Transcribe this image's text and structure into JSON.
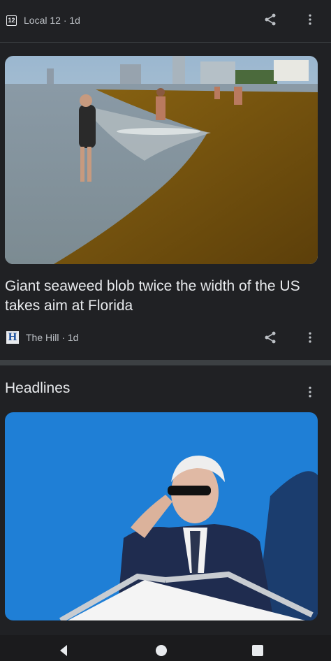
{
  "top_card": {
    "source": "Local 12",
    "age": "1d",
    "source_line": "Local 12 · 1d",
    "logo_text": "12"
  },
  "article": {
    "headline": "Giant seaweed blob twice the width of the US takes aim at Florida",
    "source": "The Hill",
    "age": "1d",
    "source_line": "The Hill · 1d",
    "logo_text": "H",
    "image_icon": "beach-seaweed-photo"
  },
  "headlines_section": {
    "title": "Headlines",
    "image_icon": "saluting-man-photo"
  },
  "icons": {
    "share": "share-icon",
    "more": "more-vert-icon"
  },
  "nav": {
    "back": "back-icon",
    "home": "home-icon",
    "recents": "recents-icon"
  },
  "colors": {
    "background": "#202124",
    "text": "#e8eaed",
    "secondary_text": "#bdc1c6",
    "divider": "#3c4043"
  }
}
